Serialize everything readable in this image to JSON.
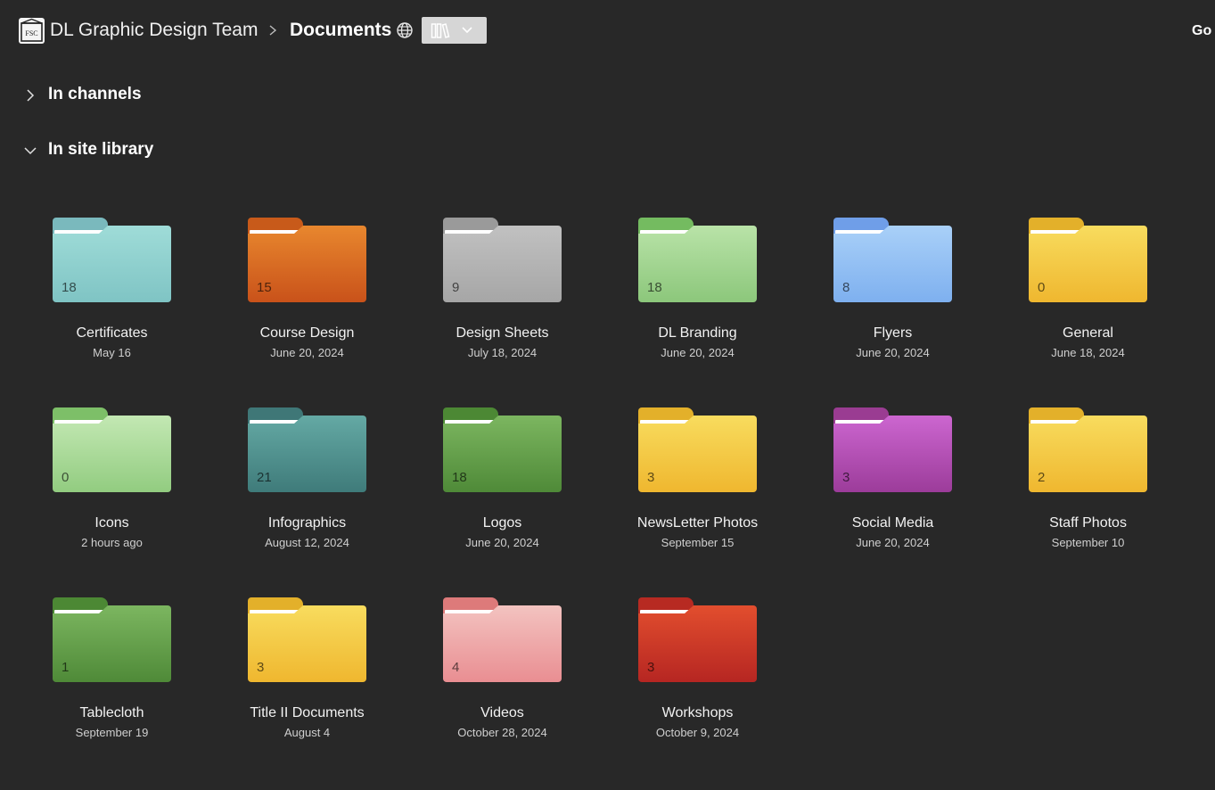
{
  "header": {
    "site_name": "DL Graphic Design Team",
    "library_name": "Documents",
    "logo_text": "FSC",
    "go_label": "Go"
  },
  "sections": {
    "channels": {
      "label": "In channels",
      "expanded": false
    },
    "site_library": {
      "label": "In site library",
      "expanded": true
    }
  },
  "folders": [
    {
      "name": "Certificates",
      "date": "May 16",
      "count": "18",
      "front": "#9fdcd8",
      "front2": "#7fc4c4",
      "back": "#7ab9bd"
    },
    {
      "name": "Course Design",
      "date": "June 20, 2024",
      "count": "15",
      "front": "#e8872e",
      "front2": "#c9521a",
      "back": "#c85a1a"
    },
    {
      "name": "Design Sheets",
      "date": "July 18, 2024",
      "count": "9",
      "front": "#c1c1c1",
      "front2": "#a6a6a6",
      "back": "#9a9a9a"
    },
    {
      "name": "DL Branding",
      "date": "June 20, 2024",
      "count": "18",
      "front": "#b9e3a8",
      "front2": "#8cc77b",
      "back": "#74bb60"
    },
    {
      "name": "Flyers",
      "date": "June 20, 2024",
      "count": "8",
      "front": "#a9d0f8",
      "front2": "#7eb0ef",
      "back": "#6f9ee8"
    },
    {
      "name": "General",
      "date": "June 18, 2024",
      "count": "0",
      "front": "#f8dc5e",
      "front2": "#efb72f",
      "back": "#e3b02a"
    },
    {
      "name": "Icons",
      "date": "2 hours ago",
      "count": "0",
      "front": "#c3e8b3",
      "front2": "#92cc80",
      "back": "#7dbf68"
    },
    {
      "name": "Infographics",
      "date": "August 12, 2024",
      "count": "21",
      "front": "#64a9a4",
      "front2": "#3f7b7a",
      "back": "#3f7777"
    },
    {
      "name": "Logos",
      "date": "June 20, 2024",
      "count": "18",
      "front": "#7cb660",
      "front2": "#4f8a38",
      "back": "#4c8834"
    },
    {
      "name": "NewsLetter Photos",
      "date": "September 15",
      "count": "3",
      "front": "#f8dc5e",
      "front2": "#efb72f",
      "back": "#e3b02a"
    },
    {
      "name": "Social Media",
      "date": "June 20, 2024",
      "count": "3",
      "front": "#cc66d0",
      "front2": "#9c3c9a",
      "back": "#9a3c92"
    },
    {
      "name": "Staff Photos",
      "date": "September 10",
      "count": "2",
      "front": "#f8dc5e",
      "front2": "#efb72f",
      "back": "#e3b02a"
    },
    {
      "name": "Tablecloth",
      "date": "September 19",
      "count": "1",
      "front": "#7cb660",
      "front2": "#4f8a38",
      "back": "#4c8834"
    },
    {
      "name": "Title II Documents",
      "date": "August 4",
      "count": "3",
      "front": "#f8dc5e",
      "front2": "#efb72f",
      "back": "#e3b02a"
    },
    {
      "name": "Videos",
      "date": "October 28, 2024",
      "count": "4",
      "front": "#f3c3c0",
      "front2": "#e98e92",
      "back": "#dd7a7a"
    },
    {
      "name": "Workshops",
      "date": "October 9, 2024",
      "count": "3",
      "front": "#e24e2e",
      "front2": "#b62622",
      "back": "#b72a22"
    }
  ]
}
